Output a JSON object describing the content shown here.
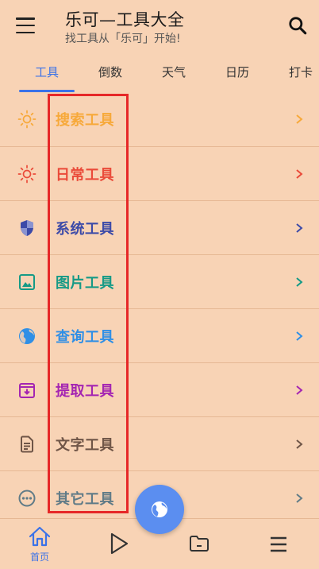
{
  "header": {
    "title": "乐可—工具大全",
    "subtitle": "找工具从「乐可」开始!"
  },
  "tabs": [
    {
      "label": "工具",
      "active": true
    },
    {
      "label": "倒数"
    },
    {
      "label": "天气"
    },
    {
      "label": "日历"
    },
    {
      "label": "打卡"
    }
  ],
  "categories": [
    {
      "label": "搜索工具",
      "icon": "sun-icon",
      "color": "#f7a93a"
    },
    {
      "label": "日常工具",
      "icon": "sun-icon",
      "color": "#ea4a39"
    },
    {
      "label": "系统工具",
      "icon": "shield-icon",
      "color": "#3c4aa8"
    },
    {
      "label": "图片工具",
      "icon": "image-icon",
      "color": "#159a86"
    },
    {
      "label": "查询工具",
      "icon": "globe-icon",
      "color": "#2f8fe6"
    },
    {
      "label": "提取工具",
      "icon": "archive-icon",
      "color": "#a425b2"
    },
    {
      "label": "文字工具",
      "icon": "document-icon",
      "color": "#6f5547"
    },
    {
      "label": "其它工具",
      "icon": "more-icon",
      "color": "#607b87"
    }
  ],
  "bottom_nav": {
    "home_label": "首页"
  },
  "colors": {
    "accent": "#3b72e8",
    "background": "#f8d3b5",
    "highlight": "#e62828"
  }
}
